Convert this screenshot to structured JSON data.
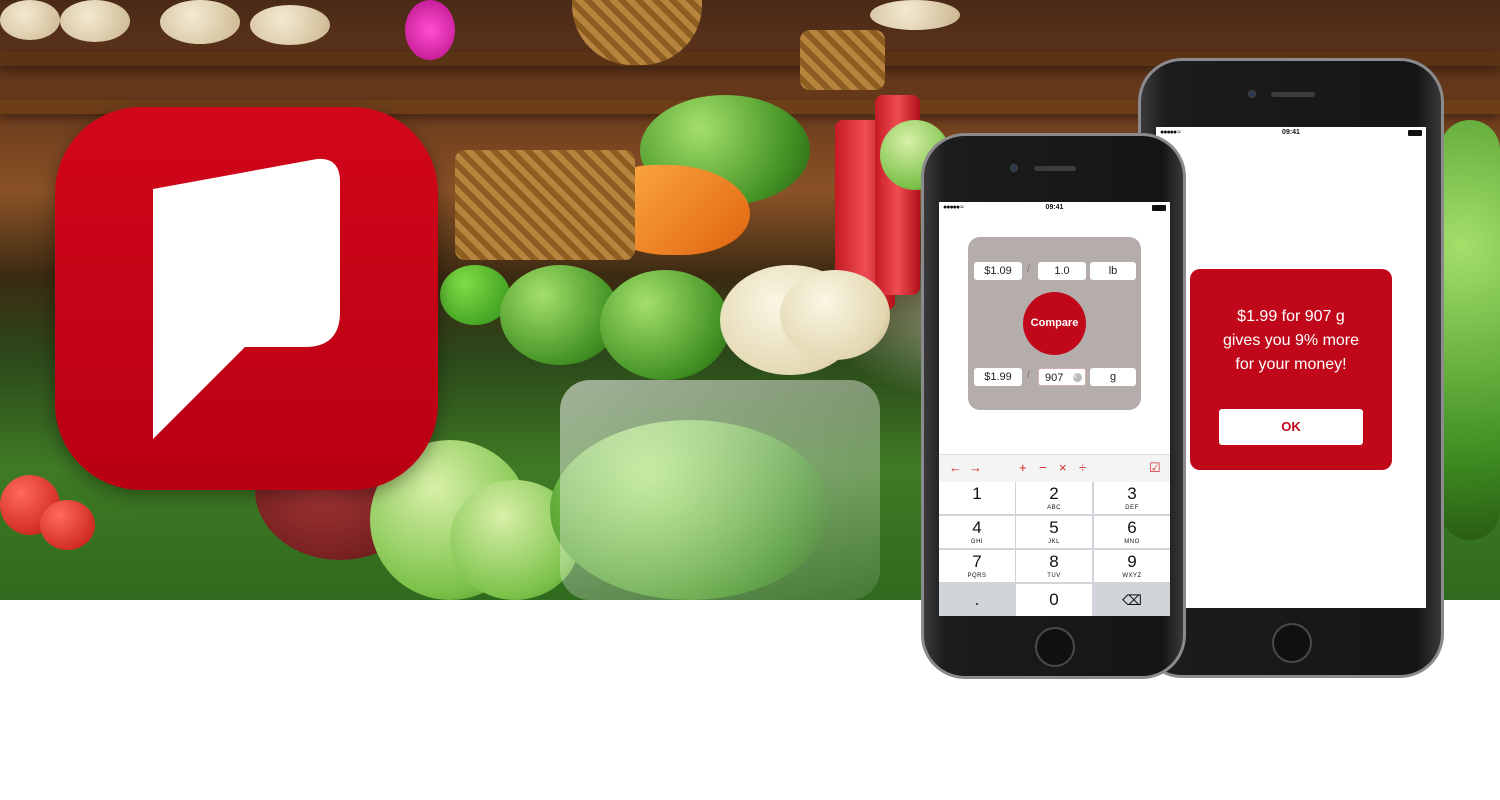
{
  "colors": {
    "brand_red": "#c0081a",
    "card_gray": "#b5acac",
    "keypad_gray": "#d1d4d9"
  },
  "front_phone": {
    "status": {
      "signal": "●●●●● ≈",
      "time": "09:41"
    },
    "comparison": {
      "first": {
        "price": "$1.09",
        "separator": "/",
        "quantity": "1.0",
        "unit": "lb"
      },
      "compare_label": "Compare",
      "second": {
        "price": "$1.99",
        "separator": "/",
        "quantity": "907",
        "unit": "g"
      }
    },
    "toolbar": {
      "back": "←",
      "forward": "→",
      "plus": "+",
      "minus": "−",
      "times": "×",
      "divide": "÷",
      "done": "☑"
    },
    "keypad": [
      {
        "num": "1",
        "letters": ""
      },
      {
        "num": "2",
        "letters": "ABC"
      },
      {
        "num": "3",
        "letters": "DEF"
      },
      {
        "num": "4",
        "letters": "GHI"
      },
      {
        "num": "5",
        "letters": "JKL"
      },
      {
        "num": "6",
        "letters": "MNO"
      },
      {
        "num": "7",
        "letters": "PQRS"
      },
      {
        "num": "8",
        "letters": "TUV"
      },
      {
        "num": "9",
        "letters": "WXYZ"
      },
      {
        "num": ".",
        "letters": ""
      },
      {
        "num": "0",
        "letters": ""
      },
      {
        "num": "⌫",
        "letters": ""
      }
    ]
  },
  "back_phone": {
    "status": {
      "signal": "●●●●● ≈",
      "time": "09:41"
    },
    "alert": {
      "line1": "$1.99 for 907 g",
      "line2": "gives you 9% more",
      "line3": "for your money!",
      "ok_label": "OK"
    }
  }
}
